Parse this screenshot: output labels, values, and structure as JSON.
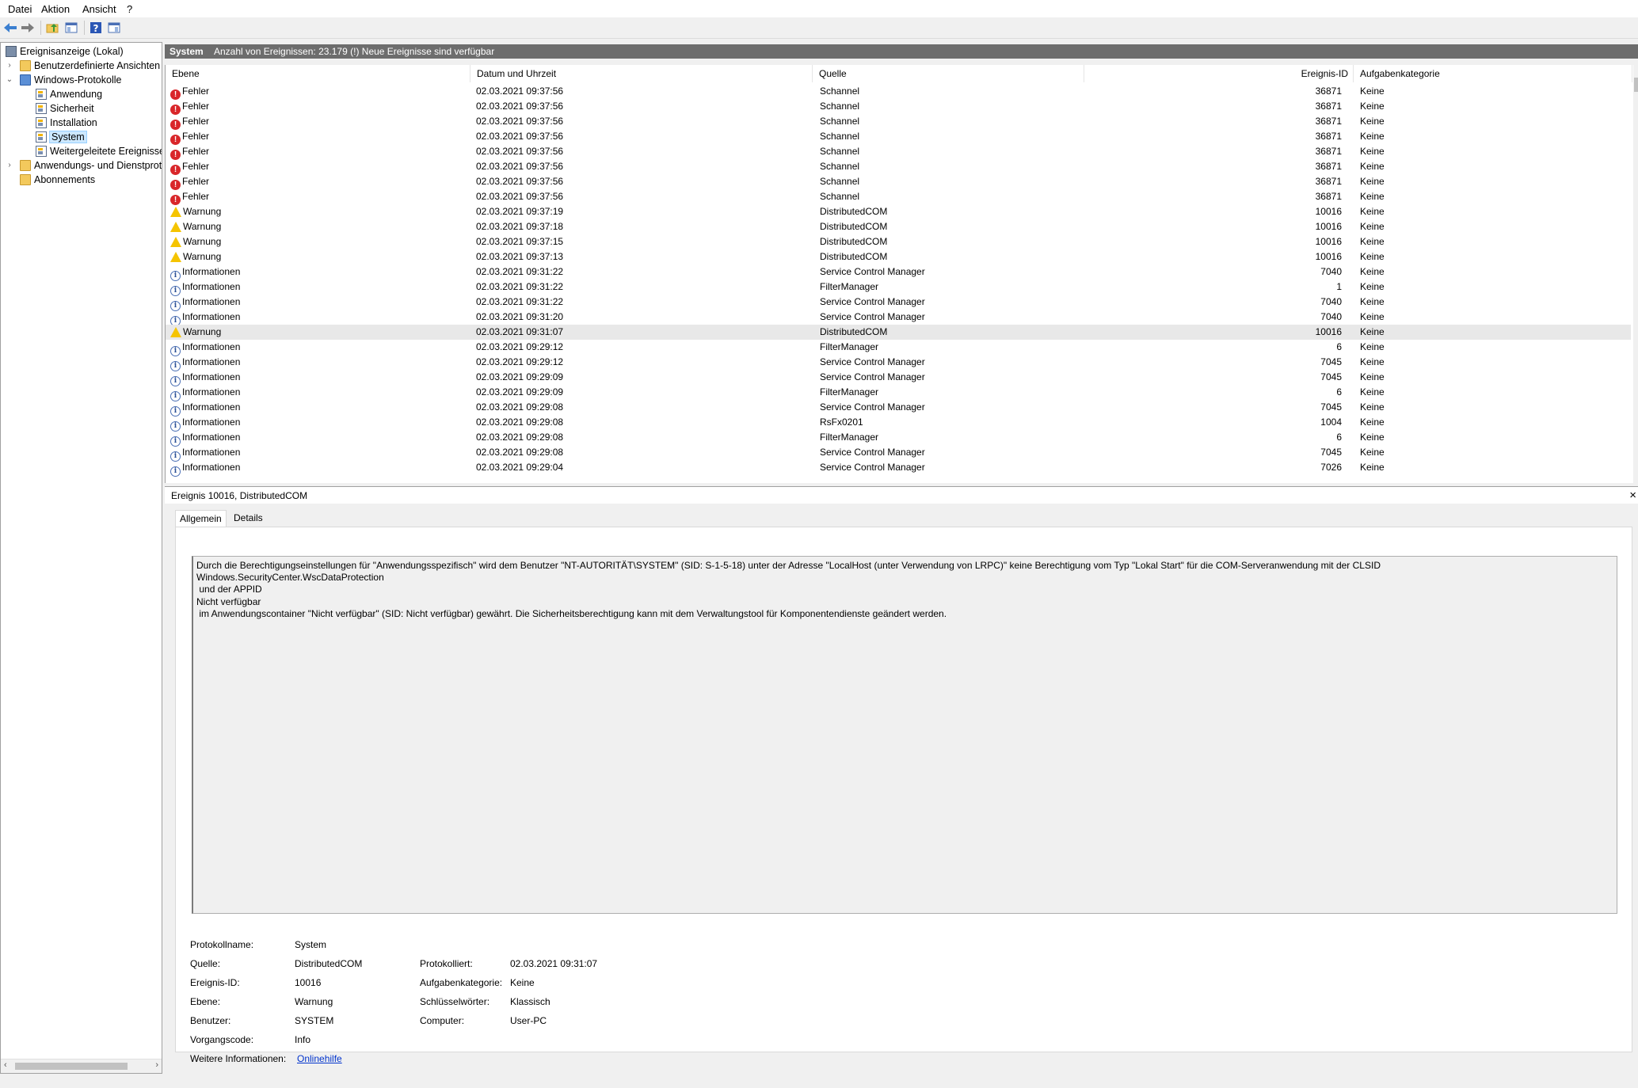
{
  "menu": {
    "datei": "Datei",
    "aktion": "Aktion",
    "ansicht": "Ansicht",
    "hilfe": "?"
  },
  "tree": {
    "root": "Ereignisanzeige (Lokal)",
    "custom_views": "Benutzerdefinierte Ansichten",
    "windows_logs": "Windows-Protokolle",
    "application": "Anwendung",
    "security": "Sicherheit",
    "setup": "Installation",
    "system": "System",
    "forwarded": "Weitergeleitete Ereignisse",
    "app_service_logs": "Anwendungs- und Dienstprot",
    "subscriptions": "Abonnements"
  },
  "header": {
    "log_name": "System",
    "info": "Anzahl von Ereignissen: 23.179 (!) Neue Ereignisse sind verfügbar"
  },
  "columns": {
    "level": "Ebene",
    "datetime": "Datum und Uhrzeit",
    "source": "Quelle",
    "event_id": "Ereignis-ID",
    "category": "Aufgabenkategorie"
  },
  "rows": [
    {
      "level": "Fehler",
      "type": "error",
      "datetime": "02.03.2021 09:37:56",
      "source": "Schannel",
      "event_id": "36871",
      "category": "Keine"
    },
    {
      "level": "Fehler",
      "type": "error",
      "datetime": "02.03.2021 09:37:56",
      "source": "Schannel",
      "event_id": "36871",
      "category": "Keine"
    },
    {
      "level": "Fehler",
      "type": "error",
      "datetime": "02.03.2021 09:37:56",
      "source": "Schannel",
      "event_id": "36871",
      "category": "Keine"
    },
    {
      "level": "Fehler",
      "type": "error",
      "datetime": "02.03.2021 09:37:56",
      "source": "Schannel",
      "event_id": "36871",
      "category": "Keine"
    },
    {
      "level": "Fehler",
      "type": "error",
      "datetime": "02.03.2021 09:37:56",
      "source": "Schannel",
      "event_id": "36871",
      "category": "Keine"
    },
    {
      "level": "Fehler",
      "type": "error",
      "datetime": "02.03.2021 09:37:56",
      "source": "Schannel",
      "event_id": "36871",
      "category": "Keine"
    },
    {
      "level": "Fehler",
      "type": "error",
      "datetime": "02.03.2021 09:37:56",
      "source": "Schannel",
      "event_id": "36871",
      "category": "Keine"
    },
    {
      "level": "Fehler",
      "type": "error",
      "datetime": "02.03.2021 09:37:56",
      "source": "Schannel",
      "event_id": "36871",
      "category": "Keine"
    },
    {
      "level": "Warnung",
      "type": "warn",
      "datetime": "02.03.2021 09:37:19",
      "source": "DistributedCOM",
      "event_id": "10016",
      "category": "Keine"
    },
    {
      "level": "Warnung",
      "type": "warn",
      "datetime": "02.03.2021 09:37:18",
      "source": "DistributedCOM",
      "event_id": "10016",
      "category": "Keine"
    },
    {
      "level": "Warnung",
      "type": "warn",
      "datetime": "02.03.2021 09:37:15",
      "source": "DistributedCOM",
      "event_id": "10016",
      "category": "Keine"
    },
    {
      "level": "Warnung",
      "type": "warn",
      "datetime": "02.03.2021 09:37:13",
      "source": "DistributedCOM",
      "event_id": "10016",
      "category": "Keine"
    },
    {
      "level": "Informationen",
      "type": "info",
      "datetime": "02.03.2021 09:31:22",
      "source": "Service Control Manager",
      "event_id": "7040",
      "category": "Keine"
    },
    {
      "level": "Informationen",
      "type": "info",
      "datetime": "02.03.2021 09:31:22",
      "source": "FilterManager",
      "event_id": "1",
      "category": "Keine"
    },
    {
      "level": "Informationen",
      "type": "info",
      "datetime": "02.03.2021 09:31:22",
      "source": "Service Control Manager",
      "event_id": "7040",
      "category": "Keine"
    },
    {
      "level": "Informationen",
      "type": "info",
      "datetime": "02.03.2021 09:31:20",
      "source": "Service Control Manager",
      "event_id": "7040",
      "category": "Keine"
    },
    {
      "level": "Warnung",
      "type": "warn",
      "datetime": "02.03.2021 09:31:07",
      "source": "DistributedCOM",
      "event_id": "10016",
      "category": "Keine",
      "selected": true
    },
    {
      "level": "Informationen",
      "type": "info",
      "datetime": "02.03.2021 09:29:12",
      "source": "FilterManager",
      "event_id": "6",
      "category": "Keine"
    },
    {
      "level": "Informationen",
      "type": "info",
      "datetime": "02.03.2021 09:29:12",
      "source": "Service Control Manager",
      "event_id": "7045",
      "category": "Keine"
    },
    {
      "level": "Informationen",
      "type": "info",
      "datetime": "02.03.2021 09:29:09",
      "source": "Service Control Manager",
      "event_id": "7045",
      "category": "Keine"
    },
    {
      "level": "Informationen",
      "type": "info",
      "datetime": "02.03.2021 09:29:09",
      "source": "FilterManager",
      "event_id": "6",
      "category": "Keine"
    },
    {
      "level": "Informationen",
      "type": "info",
      "datetime": "02.03.2021 09:29:08",
      "source": "Service Control Manager",
      "event_id": "7045",
      "category": "Keine"
    },
    {
      "level": "Informationen",
      "type": "info",
      "datetime": "02.03.2021 09:29:08",
      "source": "RsFx0201",
      "event_id": "1004",
      "category": "Keine"
    },
    {
      "level": "Informationen",
      "type": "info",
      "datetime": "02.03.2021 09:29:08",
      "source": "FilterManager",
      "event_id": "6",
      "category": "Keine"
    },
    {
      "level": "Informationen",
      "type": "info",
      "datetime": "02.03.2021 09:29:08",
      "source": "Service Control Manager",
      "event_id": "7045",
      "category": "Keine"
    },
    {
      "level": "Informationen",
      "type": "info",
      "datetime": "02.03.2021 09:29:04",
      "source": "Service Control Manager",
      "event_id": "7026",
      "category": "Keine"
    }
  ],
  "detail": {
    "title": "Ereignis 10016, DistributedCOM",
    "close": "×",
    "tab_general": "Allgemein",
    "tab_details": "Details",
    "description": "Durch die Berechtigungseinstellungen für \"Anwendungsspezifisch\" wird dem Benutzer \"NT-AUTORITÄT\\SYSTEM\" (SID: S-1-5-18) unter der Adresse \"LocalHost (unter Verwendung von LRPC)\" keine Berechtigung vom Typ \"Lokal Start\" für die COM-Serveranwendung mit der CLSID \nWindows.SecurityCenter.WscDataProtection\n und der APPID \nNicht verfügbar\n im Anwendungscontainer \"Nicht verfügbar\" (SID: Nicht verfügbar) gewährt. Die Sicherheitsberechtigung kann mit dem Verwaltungstool für Komponentendienste geändert werden.",
    "labels": {
      "log_name": "Protokollname:",
      "source": "Quelle:",
      "event_id": "Ereignis-ID:",
      "level": "Ebene:",
      "user": "Benutzer:",
      "opcode": "Vorgangscode:",
      "more_info": "Weitere Informationen:",
      "logged": "Protokolliert:",
      "category": "Aufgabenkategorie:",
      "keywords": "Schlüsselwörter:",
      "computer": "Computer:"
    },
    "values": {
      "log_name": "System",
      "source": "DistributedCOM",
      "event_id": "10016",
      "level": "Warnung",
      "user": "SYSTEM",
      "opcode": "Info",
      "more_info": "Onlinehilfe",
      "logged": "02.03.2021 09:31:07",
      "category": "Keine",
      "keywords": "Klassisch",
      "computer": "User-PC"
    }
  },
  "colors": {
    "header_bar": "#6d6d6d",
    "error": "#d9262a",
    "warning": "#f5c400",
    "info": "#4a6fb5",
    "link": "#0033cc",
    "selection": "#cce8ff"
  },
  "icons": [
    "back-arrow-icon",
    "forward-arrow-icon",
    "folder-up-icon",
    "show-hide-tree-icon",
    "help-icon",
    "action-pane-icon"
  ]
}
